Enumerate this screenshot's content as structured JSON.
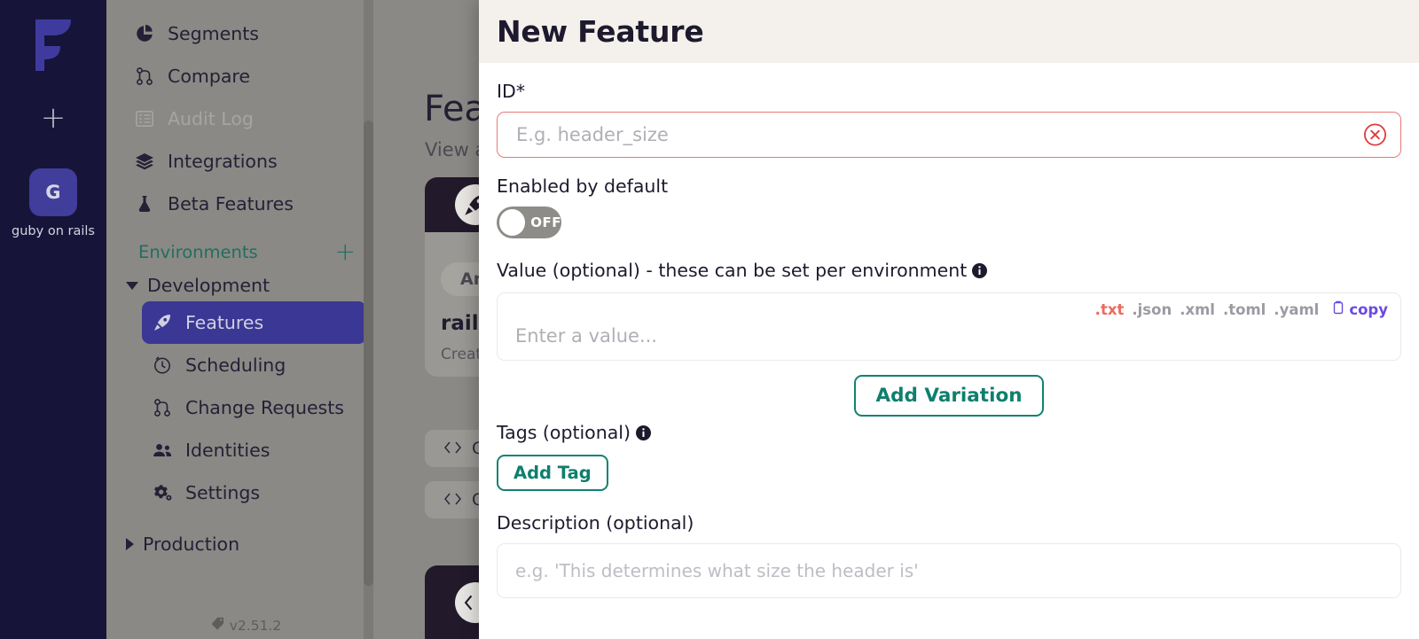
{
  "rail": {
    "logo_name": "flagsmith-logo",
    "add_label": "+",
    "org_initial": "G",
    "org_name": "guby on rails"
  },
  "sidebar": {
    "nav_items": [
      {
        "label": "Segments",
        "icon": "pie-chart-icon",
        "state": "normal"
      },
      {
        "label": "Compare",
        "icon": "compare-icon",
        "state": "normal"
      },
      {
        "label": "Audit Log",
        "icon": "list-icon",
        "state": "disabled"
      },
      {
        "label": "Integrations",
        "icon": "layers-icon",
        "state": "normal"
      },
      {
        "label": "Beta Features",
        "icon": "flask-icon",
        "state": "normal"
      }
    ],
    "environments_label": "Environments",
    "environments_add": "+",
    "groups": [
      {
        "label": "Development",
        "expanded": true,
        "items": [
          {
            "label": "Features",
            "icon": "rocket-icon",
            "active": true
          },
          {
            "label": "Scheduling",
            "icon": "clock-icon",
            "active": false
          },
          {
            "label": "Change Requests",
            "icon": "compare-icon",
            "active": false
          },
          {
            "label": "Identities",
            "icon": "users-icon",
            "active": false
          },
          {
            "label": "Settings",
            "icon": "gears-icon",
            "active": false
          }
        ]
      },
      {
        "label": "Production",
        "expanded": false,
        "items": []
      }
    ],
    "version": "v2.51.2"
  },
  "background_page": {
    "title": "Fea",
    "subtitle": "View a",
    "card": {
      "icon": "rocket-icon",
      "chip": "Arch",
      "feature_name": "rails_",
      "created": "Create"
    },
    "code_pills": [
      {
        "label": "Cod",
        "icon": "code-icon"
      },
      {
        "label": "Cod",
        "icon": "code-icon"
      }
    ],
    "code_card_icon": "code-icon"
  },
  "modal": {
    "title": "New Feature",
    "id_field": {
      "label": "ID*",
      "value": "",
      "placeholder": "E.g. header_size",
      "clear_icon": "circle-x-icon",
      "error": true
    },
    "enabled_field": {
      "label": "Enabled by default",
      "toggle_state": "OFF"
    },
    "value_field": {
      "label": "Value (optional) - these can be set per environment",
      "info_icon": "info-icon",
      "placeholder": "Enter a value...",
      "value": "",
      "extensions": [
        ".txt",
        ".json",
        ".xml",
        ".toml",
        ".yaml"
      ],
      "selected_extension": ".txt",
      "copy_label": "copy",
      "copy_icon": "clipboard-icon"
    },
    "add_variation_label": "Add Variation",
    "tags_field": {
      "label": "Tags (optional)",
      "info_icon": "info-icon",
      "add_tag_label": "Add Tag"
    },
    "description_field": {
      "label": "Description (optional)",
      "value": "",
      "placeholder": "e.g. 'This determines what size the header is'"
    }
  },
  "colors": {
    "rail_bg": "#17143a",
    "sidebar_bg": "#8b8985",
    "accent_purple": "#413d9a",
    "active_nav": "#3b3794",
    "teal": "#0e7f6e",
    "error_red": "#e87a77",
    "ext_selected": "#ea6b5e",
    "copy_purple": "#6d4ae0",
    "modal_header_bg": "#f4f1ec"
  }
}
